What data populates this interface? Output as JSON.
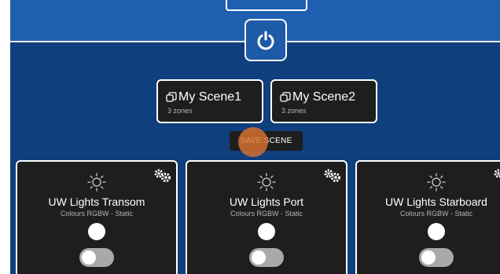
{
  "power": {
    "icon": "power-icon"
  },
  "scenes": [
    {
      "icon": "copy-icon",
      "name": "My Scene1",
      "zones": "3 zones"
    },
    {
      "icon": "copy-icon",
      "name": "My Scene2",
      "zones": "3 zones"
    }
  ],
  "save_scene": {
    "label": "SAVE SCENE"
  },
  "zones": [
    {
      "name": "UW Lights Transom",
      "mode": "Colours RGBW - Static",
      "color": "#ffffff",
      "on": false,
      "icon": "sun-icon",
      "settings_icon": "gears-icon"
    },
    {
      "name": "UW Lights Port",
      "mode": "Colours RGBW - Static",
      "color": "#ffffff",
      "on": false,
      "icon": "sun-icon",
      "settings_icon": "gears-icon"
    },
    {
      "name": "UW Lights Starboard",
      "mode": "Colours RGBW - Static",
      "color": "#ffffff",
      "on": false,
      "icon": "sun-icon",
      "settings_icon": "gears-icon"
    }
  ],
  "colors": {
    "background": "#0f3f7c",
    "top_band": "#1f5fb0",
    "card": "#1e1e1e",
    "toggle_off": "#a9a9a9",
    "touch_indicator": "#db7230"
  }
}
